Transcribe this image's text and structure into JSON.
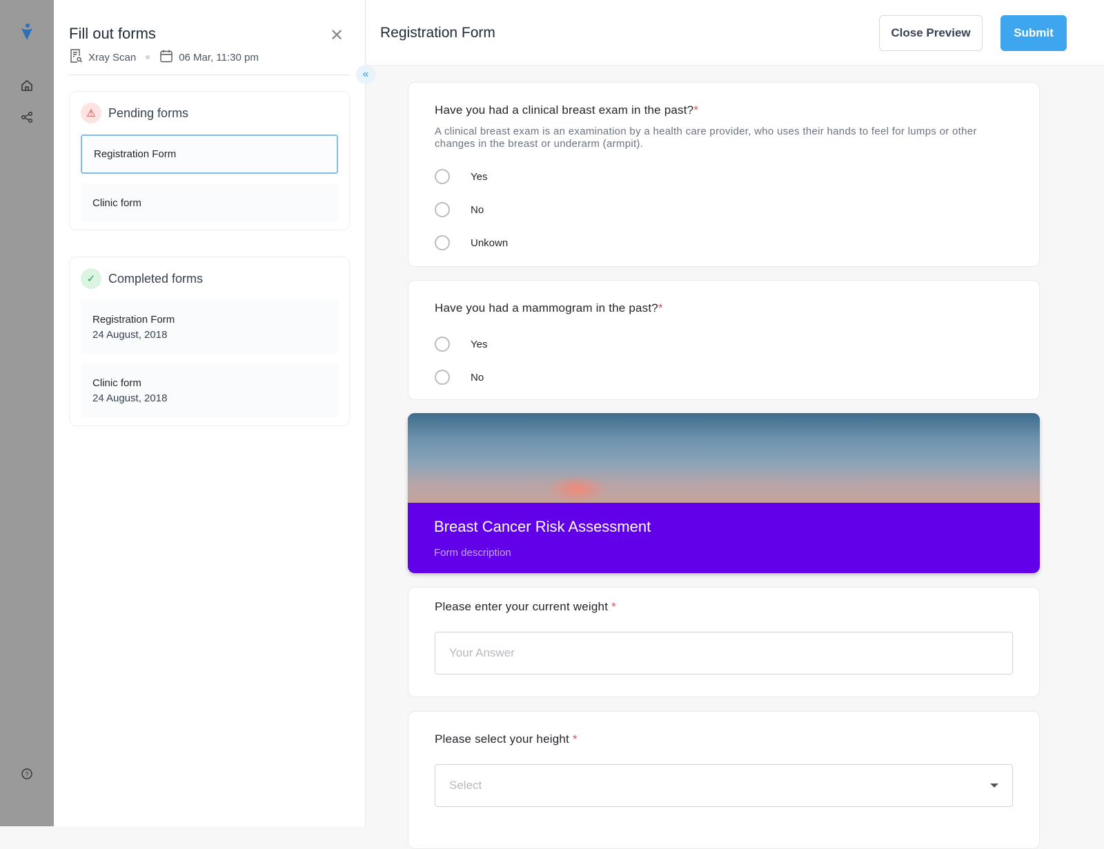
{
  "panel": {
    "title": "Fill out forms",
    "exam": "Xray Scan",
    "datetime": "06 Mar, 11:30 pm",
    "pending": {
      "title": "Pending forms",
      "items": [
        {
          "label": "Registration Form"
        },
        {
          "label": "Clinic form"
        }
      ]
    },
    "completed": {
      "title": "Completed forms",
      "items": [
        {
          "label": "Registration Form",
          "date": "24 August, 2018"
        },
        {
          "label": "Clinic form",
          "date": "24 August, 2018"
        }
      ]
    }
  },
  "header": {
    "title": "Registration Form",
    "close_preview": "Close Preview",
    "submit": "Submit"
  },
  "questions": [
    {
      "text": "Have you had a clinical breast exam in the past?",
      "required": "*",
      "description": "A clinical breast exam is an examination by a health care provider, who uses their hands to feel for lumps or other changes in the breast or underarm (armpit).",
      "options": [
        "Yes",
        "No",
        "Unkown"
      ]
    },
    {
      "text": "Have you had a mammogram in the past?",
      "required": "*",
      "options": [
        "Yes",
        "No"
      ]
    }
  ],
  "banner": {
    "title": "Breast Cancer Risk Assessment",
    "description": "Form description"
  },
  "weight": {
    "text": "Please enter your current weight",
    "required": "*",
    "placeholder": "Your Answer"
  },
  "height": {
    "text": "Please select your height",
    "required": "*",
    "placeholder": "Select"
  },
  "colors": {
    "accent": "#3ea6ef",
    "banner": "#6200ea"
  }
}
